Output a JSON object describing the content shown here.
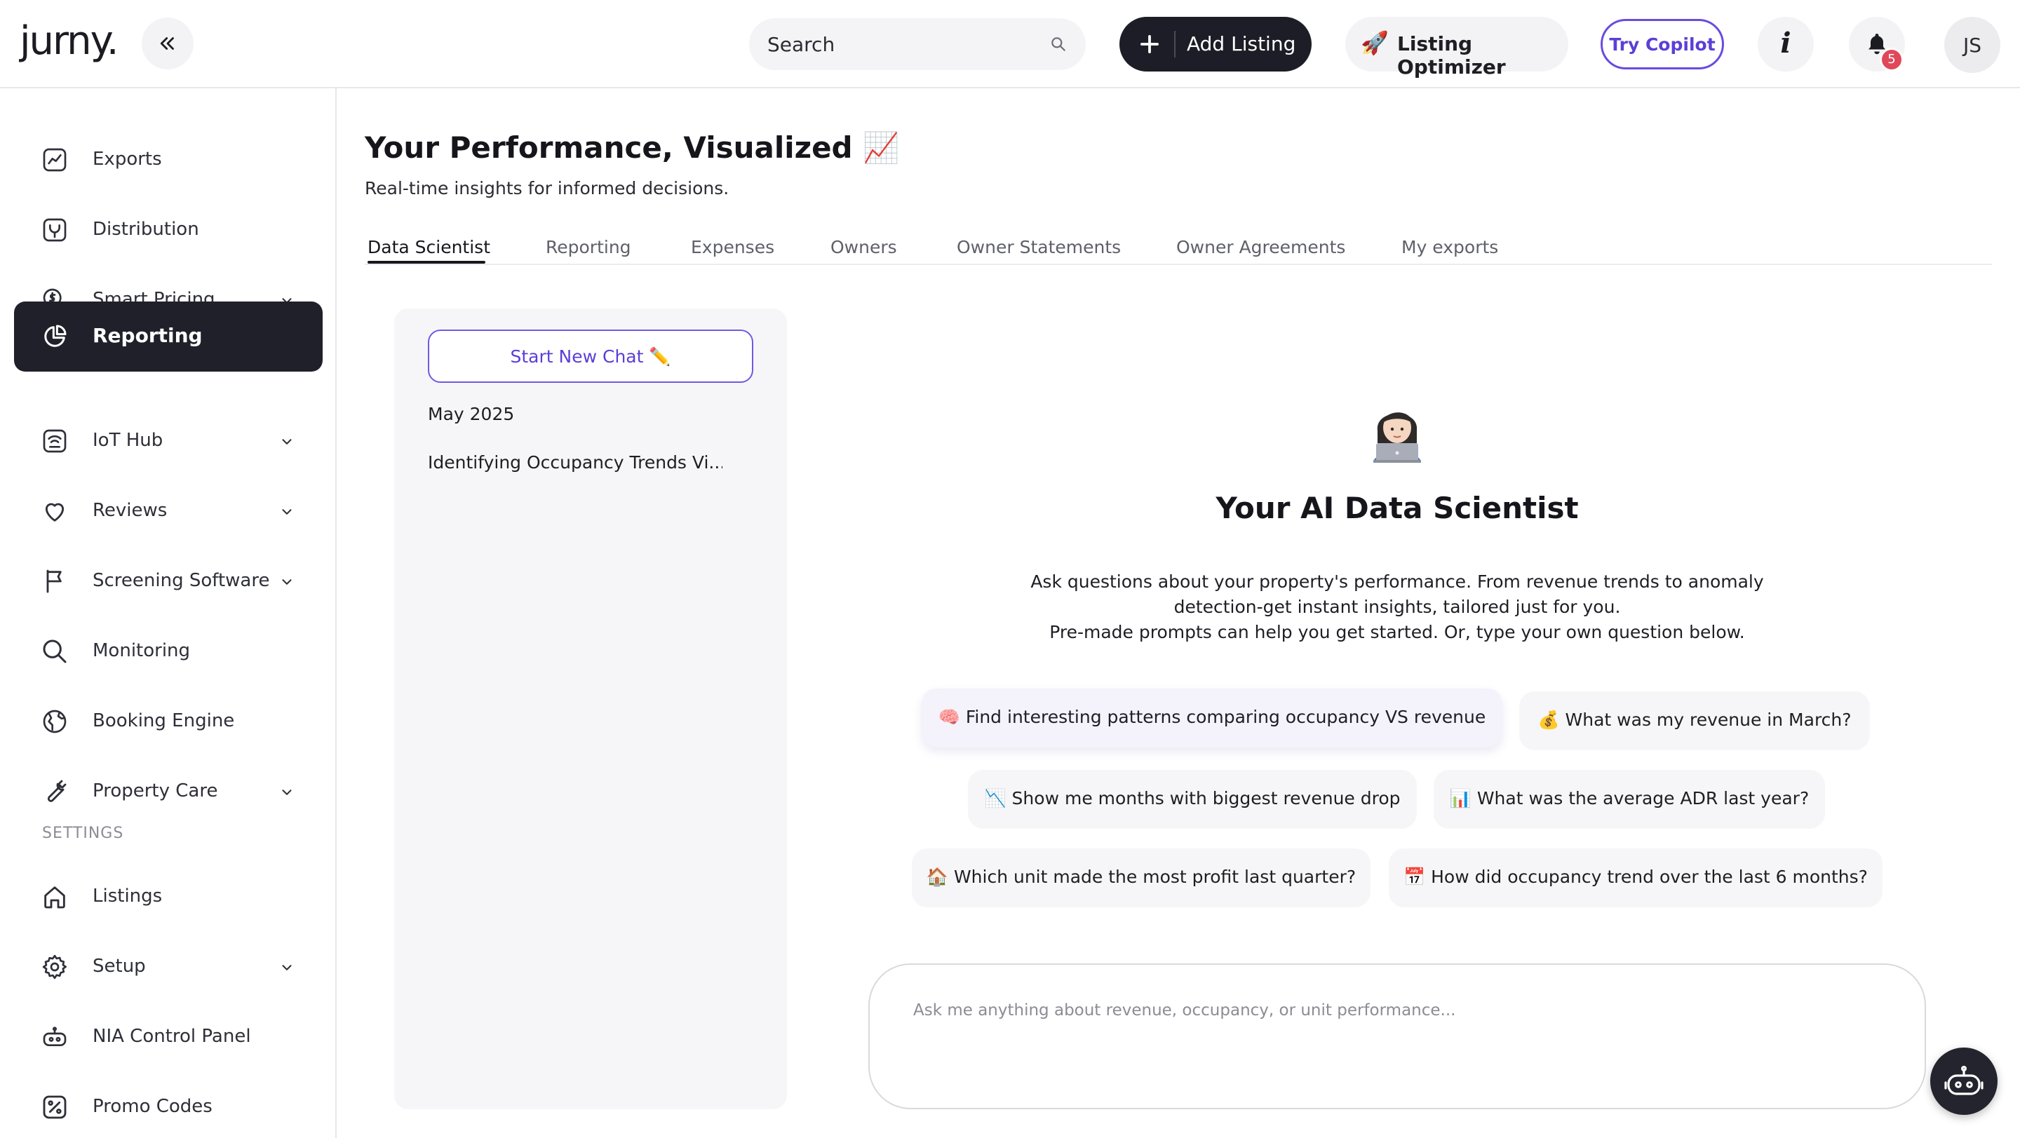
{
  "header": {
    "logo": "jurny.",
    "search_placeholder": "Search",
    "add_listing_label": "Add Listing",
    "optimizer_label": "Listing Optimizer",
    "optimizer_icon": "🚀",
    "copilot_label": "Try Copilot",
    "info_label": "i",
    "notification_count": "5",
    "avatar_initials": "JS"
  },
  "sidebar": {
    "items": [
      {
        "label": "Exports"
      },
      {
        "label": "Distribution"
      },
      {
        "label": "Smart Pricing"
      },
      {
        "label": "Reporting"
      },
      {
        "label": "IoT Hub"
      },
      {
        "label": "Reviews"
      },
      {
        "label": "Screening Software"
      },
      {
        "label": "Monitoring"
      },
      {
        "label": "Booking Engine"
      },
      {
        "label": "Property Care"
      }
    ],
    "settings_heading": "SETTINGS",
    "settings_items": [
      {
        "label": "Listings"
      },
      {
        "label": "Setup"
      },
      {
        "label": "NIA Control Panel"
      },
      {
        "label": "Promo Codes"
      }
    ]
  },
  "main": {
    "title": "Your Performance, Visualized 📈",
    "subtitle": "Real-time insights for informed decisions.",
    "tabs": [
      {
        "label": "Data Scientist"
      },
      {
        "label": "Reporting"
      },
      {
        "label": "Expenses"
      },
      {
        "label": "Owners"
      },
      {
        "label": "Owner Statements"
      },
      {
        "label": "Owner Agreements"
      },
      {
        "label": "My exports"
      }
    ],
    "history": {
      "new_chat_label": "Start New Chat ✏️",
      "month": "May 2025",
      "items": [
        "Identifying Occupancy Trends Vi..."
      ]
    },
    "assistant": {
      "title": "Your AI Data Scientist",
      "desc_line1": "Ask questions about your property's performance. From revenue trends to anomaly",
      "desc_line2": "detection-get instant insights, tailored just for you.",
      "desc_line3": "Pre-made prompts can help you get started. Or, type your own question below."
    },
    "prompts": [
      "🧠 Find interesting patterns comparing occupancy VS revenue",
      "💰 What was my revenue in March?",
      "📉 Show me months with biggest revenue drop",
      "📊 What was the average ADR last year?",
      "🏠 Which unit made the most profit last quarter?",
      "📅 How did occupancy trend over the last 6 months?"
    ],
    "ask_placeholder": "Ask me anything about revenue, occupancy, or unit performance..."
  },
  "colors": {
    "accent": "#5b3fd6",
    "dark": "#1f2029",
    "badge": "#e0485a"
  }
}
